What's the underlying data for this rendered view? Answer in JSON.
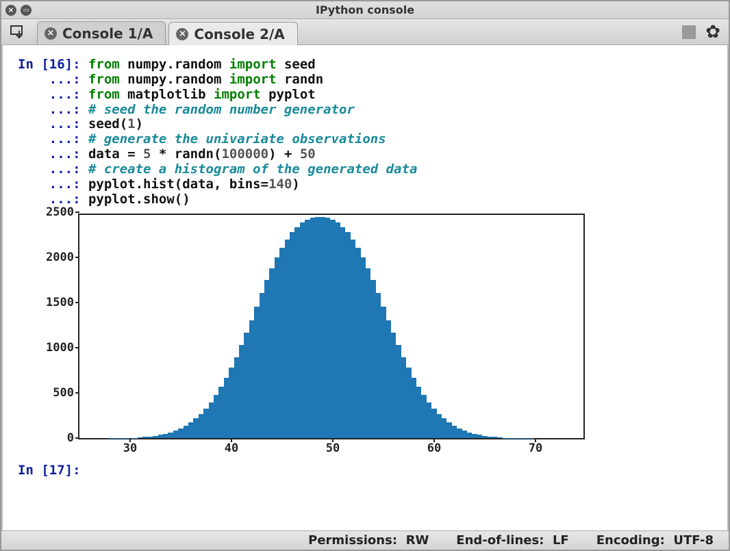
{
  "window": {
    "title": "IPython console"
  },
  "tabs": [
    {
      "label": "Console 1/A",
      "active": false
    },
    {
      "label": "Console 2/A",
      "active": true
    }
  ],
  "code": {
    "in_count": 16,
    "next_prompt": 17,
    "lines": [
      {
        "prompt": "In [16]: ",
        "tokens": [
          {
            "cls": "c-keyword",
            "t": "from "
          },
          {
            "cls": "c-text",
            "t": "numpy"
          },
          {
            "cls": "c-text",
            "t": "."
          },
          {
            "cls": "c-text",
            "t": "random "
          },
          {
            "cls": "c-keyword",
            "t": "import "
          },
          {
            "cls": "c-text",
            "t": "seed"
          }
        ]
      },
      {
        "prompt": "    ...: ",
        "tokens": [
          {
            "cls": "c-keyword",
            "t": "from "
          },
          {
            "cls": "c-text",
            "t": "numpy"
          },
          {
            "cls": "c-text",
            "t": "."
          },
          {
            "cls": "c-text",
            "t": "random "
          },
          {
            "cls": "c-keyword",
            "t": "import "
          },
          {
            "cls": "c-text",
            "t": "randn"
          }
        ]
      },
      {
        "prompt": "    ...: ",
        "tokens": [
          {
            "cls": "c-keyword",
            "t": "from "
          },
          {
            "cls": "c-text",
            "t": "matplotlib "
          },
          {
            "cls": "c-keyword",
            "t": "import "
          },
          {
            "cls": "c-text",
            "t": "pyplot"
          }
        ]
      },
      {
        "prompt": "    ...: ",
        "tokens": [
          {
            "cls": "c-comment",
            "t": "# seed the random number generator"
          }
        ]
      },
      {
        "prompt": "    ...: ",
        "tokens": [
          {
            "cls": "c-text",
            "t": "seed("
          },
          {
            "cls": "c-number",
            "t": "1"
          },
          {
            "cls": "c-text",
            "t": ")"
          }
        ]
      },
      {
        "prompt": "    ...: ",
        "tokens": [
          {
            "cls": "c-comment",
            "t": "# generate the univariate observations"
          }
        ]
      },
      {
        "prompt": "    ...: ",
        "tokens": [
          {
            "cls": "c-text",
            "t": "data = "
          },
          {
            "cls": "c-number",
            "t": "5"
          },
          {
            "cls": "c-text",
            "t": " * randn("
          },
          {
            "cls": "c-number",
            "t": "100000"
          },
          {
            "cls": "c-text",
            "t": ") + "
          },
          {
            "cls": "c-number",
            "t": "50"
          }
        ]
      },
      {
        "prompt": "    ...: ",
        "tokens": [
          {
            "cls": "c-comment",
            "t": "# create a histogram of the generated data"
          }
        ]
      },
      {
        "prompt": "    ...: ",
        "tokens": [
          {
            "cls": "c-text",
            "t": "pyplot.hist(data, bins="
          },
          {
            "cls": "c-number",
            "t": "140"
          },
          {
            "cls": "c-text",
            "t": ")"
          }
        ]
      },
      {
        "prompt": "    ...: ",
        "tokens": [
          {
            "cls": "c-text",
            "t": "pyplot.show()"
          }
        ]
      }
    ]
  },
  "chart_data": {
    "type": "histogram",
    "title": "",
    "xlabel": "",
    "ylabel": "",
    "xlim": [
      25,
      75
    ],
    "ylim": [
      0,
      2500
    ],
    "x_ticks": [
      30,
      40,
      50,
      60,
      70
    ],
    "y_ticks": [
      0,
      500,
      1000,
      1500,
      2000,
      2500
    ],
    "bar_color": "#1f77b4",
    "bins": 140,
    "bin_centers": [
      26,
      26.5,
      27,
      27.5,
      28,
      28.5,
      29,
      29.5,
      30,
      30.5,
      31,
      31.5,
      32,
      32.5,
      33,
      33.5,
      34,
      34.5,
      35,
      35.5,
      36,
      36.5,
      37,
      37.5,
      38,
      38.5,
      39,
      39.5,
      40,
      40.5,
      41,
      41.5,
      42,
      42.5,
      43,
      43.5,
      44,
      44.5,
      45,
      45.5,
      46,
      46.5,
      47,
      47.5,
      48,
      48.5,
      49,
      49.5,
      50,
      50.5,
      51,
      51.5,
      52,
      52.5,
      53,
      53.5,
      54,
      54.5,
      55,
      55.5,
      56,
      56.5,
      57,
      57.5,
      58,
      58.5,
      59,
      59.5,
      60,
      60.5,
      61,
      61.5,
      62,
      62.5,
      63,
      63.5,
      64,
      64.5,
      65,
      65.5,
      66,
      66.5,
      67,
      67.5,
      68,
      68.5,
      69,
      69.5,
      70,
      70.5,
      71,
      71.5,
      72,
      72.5,
      73,
      73.5,
      74
    ],
    "counts": [
      0,
      0,
      0,
      0,
      1,
      1,
      2,
      3,
      5,
      7,
      10,
      15,
      20,
      28,
      38,
      50,
      65,
      85,
      110,
      140,
      175,
      220,
      270,
      330,
      400,
      480,
      570,
      670,
      780,
      900,
      1030,
      1170,
      1310,
      1460,
      1610,
      1750,
      1880,
      2000,
      2110,
      2200,
      2280,
      2340,
      2390,
      2420,
      2440,
      2450,
      2450,
      2440,
      2420,
      2390,
      2340,
      2280,
      2200,
      2110,
      2000,
      1880,
      1750,
      1610,
      1460,
      1310,
      1170,
      1030,
      900,
      780,
      670,
      570,
      480,
      400,
      330,
      270,
      220,
      175,
      140,
      110,
      85,
      65,
      50,
      38,
      28,
      20,
      15,
      10,
      7,
      5,
      3,
      2,
      1,
      1,
      0,
      0,
      0,
      0,
      0,
      0,
      0,
      0,
      0
    ]
  },
  "statusbar": {
    "permissions_label": "Permissions:",
    "permissions_value": "RW",
    "eol_label": "End-of-lines:",
    "eol_value": "LF",
    "encoding_label": "Encoding:",
    "encoding_value": "UTF-8"
  }
}
